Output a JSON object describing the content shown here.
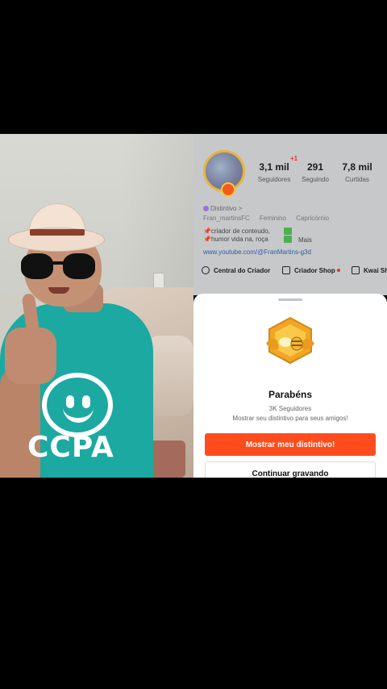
{
  "profile": {
    "plus_badge": "+1",
    "stats": [
      {
        "value": "3,1 mil",
        "label": "Seguidores"
      },
      {
        "value": "291",
        "label": "Seguindo"
      },
      {
        "value": "7,8 mil",
        "label": "Curtidas"
      }
    ],
    "distintivo": "Distintivo >",
    "username": "Fran_martinsFC",
    "gender": "Feminino",
    "sign": "Capricórnio",
    "bio_line1": "📌criador de conteudo,",
    "bio_line2": "📌humor vida na, roça",
    "more": "Mais",
    "youtube": "www.youtube.com/@FranMartins-g3d",
    "actions": [
      {
        "label": "Central do Criador",
        "icon": "creator-center-icon"
      },
      {
        "label": "Criador Shop",
        "icon": "shop-icon"
      },
      {
        "label": "Kwai Sh",
        "icon": "bag-icon"
      }
    ]
  },
  "sheet": {
    "title": "Parabéns",
    "followers_text": "3K Seguidores",
    "description": "Mostrar seu distintivo para seus amigos!",
    "primary_button": "Mostrar meu distintivo!",
    "secondary_button": "Continuar gravando"
  },
  "camera": {
    "shirt_text": "CCPA"
  },
  "colors": {
    "accent": "#fe4c1d",
    "shirt": "#1ba9a1",
    "medal": "#f2a623"
  }
}
